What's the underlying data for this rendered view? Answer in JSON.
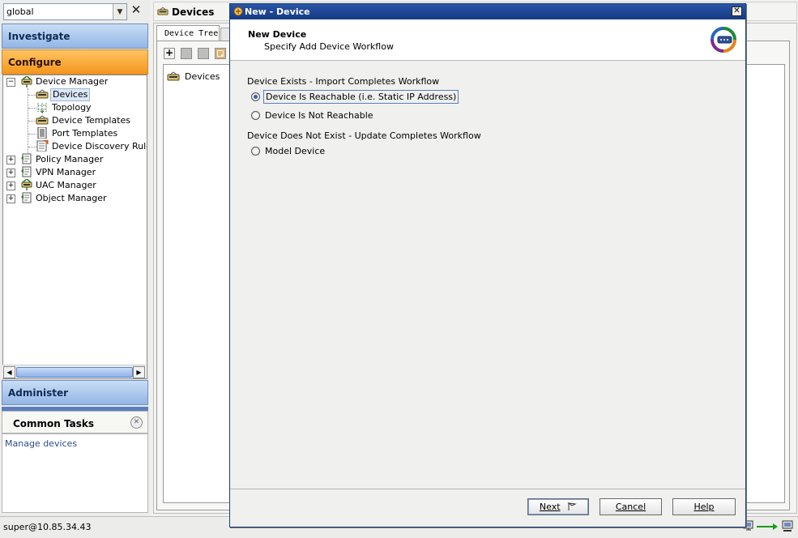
{
  "scope": {
    "value": "global",
    "close_glyph": "✕"
  },
  "nav": {
    "investigate": "Investigate",
    "configure": "Configure",
    "administer": "Administer"
  },
  "tree": {
    "items": [
      {
        "label": "Device Manager",
        "icon": "device-manager-icon"
      },
      {
        "label": "Devices",
        "icon": "devices-icon"
      },
      {
        "label": "Topology",
        "icon": "topology-icon"
      },
      {
        "label": "Device Templates",
        "icon": "device-templates-icon"
      },
      {
        "label": "Port Templates",
        "icon": "port-templates-icon"
      },
      {
        "label": "Device Discovery Rules",
        "icon": "discovery-rules-icon"
      },
      {
        "label": "Policy Manager",
        "icon": "policy-manager-icon"
      },
      {
        "label": "VPN Manager",
        "icon": "vpn-manager-icon"
      },
      {
        "label": "UAC Manager",
        "icon": "uac-manager-icon"
      },
      {
        "label": "Object Manager",
        "icon": "object-manager-icon"
      }
    ]
  },
  "common_tasks": {
    "title": "Common Tasks",
    "link": "Manage devices"
  },
  "status": {
    "user": "super@10.85.34.43"
  },
  "devices_panel": {
    "title": "Devices",
    "tab": "Device Tree",
    "tree_item": "Devices"
  },
  "dialog": {
    "title": "New - Device",
    "heading": "New Device",
    "subheading": "Specify Add Device Workflow",
    "section1": "Device Exists - Import Completes Workflow",
    "option_reachable": "Device Is Reachable (i.e. Static IP Address)",
    "option_not_reachable": "Device Is Not Reachable",
    "section2": "Device Does Not Exist - Update Completes Workflow",
    "option_model": "Model Device",
    "selected_option": "Device Is Reachable (i.e. Static IP Address)",
    "buttons": {
      "next": "Next",
      "cancel": "Cancel",
      "help": "Help"
    }
  },
  "colors": {
    "accent": "#1f4c9e",
    "configure_active": "#f4961e",
    "nav_blue": "#93b6e5"
  }
}
